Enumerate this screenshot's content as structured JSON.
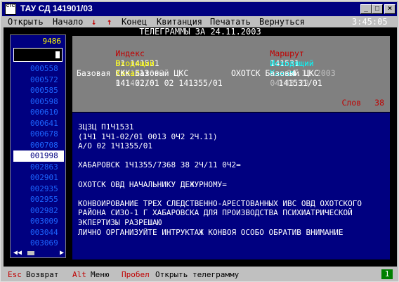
{
  "window": {
    "title": "ТАУ СД 141901/03",
    "icon_text": "CTC",
    "buttons": {
      "minimize": "_",
      "maximize": "□",
      "close": "×"
    }
  },
  "menu": {
    "items": [
      "Открыть",
      "Начало",
      "↓",
      "↑",
      "Конец",
      "Квитанция",
      "Печатать",
      "Вернуться"
    ],
    "clock": "3:45:05"
  },
  "header": {
    "title": "ТЕЛЕГРАММЫ ЗА 24.11.2003"
  },
  "left": {
    "count": "9486",
    "list": [
      "000558",
      "000572",
      "000585",
      "000598",
      "000610",
      "000641",
      "000678",
      "000708",
      "001998",
      "002863",
      "002901",
      "002935",
      "002955",
      "002982",
      "003009",
      "003044",
      "003069"
    ],
    "selected_index": 8,
    "scroll_left": "◀◀",
    "scroll_right": "▶"
  },
  "info": {
    "index_label": "Индекс",
    "index_value": "01 141531",
    "index_date": "24.11.2003",
    "route_label": "Маршрут",
    "route_value": "141531",
    "route_date": "24.11.2003",
    "incoming_label": "Входящий",
    "incoming_value": "13",
    "incoming_time": "04:42:16",
    "outgoing_label": "Исходящий",
    "outgoing_value": "4",
    "outgoing_time": "04:43:29",
    "channel1_label": "Канал",
    "channel1_value": "141-02/01 02 141355/01",
    "channel2_label": "Канал",
    "channel2_value": "141531/01",
    "base_left": "Базовая СКК Базовый ЦКС",
    "base_right": "ОХОТСК Базовый ЦКС",
    "words_label": "Слов",
    "words_value": "38"
  },
  "message": {
    "lines": [
      "ЗЦЗЦ П1Ч1531",
      "(1Ч1 1Ч1-02/01 0013 0Ч2 2Ч.11)",
      "А/О 02 1Ч1355/01",
      "",
      "ХАБАРОВСК 1Ч1355/7368 38 2Ч/11 0Ч2=",
      "",
      "ОХОТСК ОВД НАЧАЛЬНИКУ ДЕЖУРНОМУ=",
      "",
      "КОНВОИРОВАНИЕ ТРЕХ СЛЕДСТВЕННО-АРЕСТОВАННЫХ ИВС ОВД ОХОТСКОГО",
      "РАЙОНА СИЗО-1 Г ХАБАРОВСКА ДЛЯ ПРОИЗВОДСТВА ПСИХИАТРИЧЕСКОЙ",
      "ЭКПЕРТИЗЫ РАЗРЕШАЮ",
      "ЛИЧНО ОРГАНИЗУЙТЕ ИНТРУКТАЖ КОНВОЯ ОСОБО ОБРАТИВ ВНИМАНИЕ"
    ]
  },
  "status": {
    "esc_key": "Esc",
    "esc_label": "Возврат",
    "alt_key": "Alt",
    "alt_label": "Меню",
    "space_key": "Пробел",
    "space_label": "Открыть телеграмму",
    "badge": "1"
  }
}
